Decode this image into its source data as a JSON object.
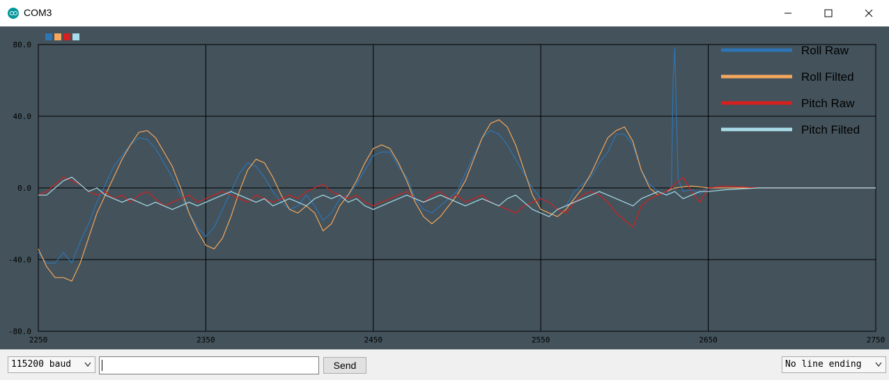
{
  "window": {
    "title": "COM3"
  },
  "plotter": {
    "legend_swatches": [
      "#2e75b6",
      "#f4a75d",
      "#d62020",
      "#a8dce8"
    ],
    "legend_panel": [
      {
        "label": "Roll Raw",
        "color": "#2e75b6"
      },
      {
        "label": "Roll Filted",
        "color": "#f4a75d"
      },
      {
        "label": "Pitch Raw",
        "color": "#d62020"
      },
      {
        "label": "Pitch Filted",
        "color": "#a8dce8"
      }
    ]
  },
  "chart_data": {
    "type": "line",
    "title": "",
    "xlabel": "",
    "ylabel": "",
    "xlim": [
      2250,
      2750
    ],
    "ylim": [
      -80,
      80
    ],
    "x_ticks": [
      "2250",
      "2350",
      "2450",
      "2550",
      "2650",
      "2750"
    ],
    "y_ticks": [
      "80.0",
      "40.0",
      "0.0",
      "-40.0",
      "-80.0"
    ],
    "grid": true,
    "series": [
      {
        "name": "Roll Raw",
        "color": "#2e75b6",
        "x": [
          2250,
          2255,
          2260,
          2265,
          2270,
          2275,
          2280,
          2285,
          2290,
          2295,
          2300,
          2305,
          2310,
          2315,
          2320,
          2325,
          2330,
          2335,
          2340,
          2345,
          2350,
          2355,
          2360,
          2365,
          2370,
          2375,
          2380,
          2385,
          2390,
          2395,
          2400,
          2405,
          2410,
          2415,
          2420,
          2425,
          2430,
          2435,
          2440,
          2445,
          2450,
          2455,
          2460,
          2465,
          2470,
          2475,
          2480,
          2485,
          2490,
          2495,
          2500,
          2505,
          2510,
          2515,
          2520,
          2525,
          2530,
          2535,
          2540,
          2545,
          2550,
          2555,
          2560,
          2565,
          2570,
          2575,
          2580,
          2585,
          2590,
          2595,
          2600,
          2605,
          2610,
          2615,
          2620,
          2625,
          2628,
          2629,
          2630,
          2632,
          2635,
          2640,
          2645,
          2650,
          2660,
          2680,
          2700,
          2720,
          2750
        ],
        "y": [
          -36,
          -42,
          -42,
          -36,
          -42,
          -30,
          -20,
          -8,
          2,
          12,
          18,
          24,
          28,
          27,
          22,
          14,
          6,
          -4,
          -14,
          -22,
          -27,
          -22,
          -12,
          -2,
          8,
          14,
          12,
          6,
          -2,
          -8,
          -12,
          -10,
          -4,
          -10,
          -18,
          -14,
          -6,
          -4,
          2,
          10,
          18,
          20,
          20,
          12,
          6,
          -6,
          -12,
          -14,
          -10,
          -6,
          -2,
          8,
          18,
          28,
          32,
          30,
          24,
          16,
          8,
          0,
          -6,
          -8,
          -12,
          -10,
          -2,
          2,
          6,
          14,
          20,
          30,
          30,
          24,
          10,
          2,
          -2,
          -4,
          0,
          60,
          78,
          5,
          -2,
          -1,
          -3,
          0,
          0,
          0,
          0,
          0,
          0
        ]
      },
      {
        "name": "Roll Filted",
        "color": "#f4a75d",
        "x": [
          2250,
          2255,
          2260,
          2265,
          2270,
          2275,
          2280,
          2285,
          2290,
          2295,
          2300,
          2305,
          2310,
          2315,
          2320,
          2325,
          2330,
          2335,
          2340,
          2345,
          2350,
          2355,
          2360,
          2365,
          2370,
          2375,
          2380,
          2385,
          2390,
          2395,
          2400,
          2405,
          2410,
          2415,
          2420,
          2425,
          2430,
          2435,
          2440,
          2445,
          2450,
          2455,
          2460,
          2465,
          2470,
          2475,
          2480,
          2485,
          2490,
          2495,
          2500,
          2505,
          2510,
          2515,
          2520,
          2525,
          2530,
          2535,
          2540,
          2545,
          2550,
          2555,
          2560,
          2565,
          2570,
          2575,
          2580,
          2585,
          2590,
          2595,
          2600,
          2605,
          2610,
          2615,
          2620,
          2625,
          2630,
          2640,
          2650,
          2660,
          2680,
          2700,
          2720,
          2750
        ],
        "y": [
          -34,
          -44,
          -50,
          -50,
          -52,
          -42,
          -28,
          -14,
          -4,
          6,
          16,
          24,
          31,
          32,
          28,
          20,
          12,
          0,
          -14,
          -24,
          -32,
          -34,
          -28,
          -16,
          -2,
          10,
          16,
          14,
          6,
          -4,
          -12,
          -14,
          -10,
          -14,
          -24,
          -20,
          -10,
          -4,
          4,
          14,
          22,
          24,
          22,
          14,
          4,
          -8,
          -16,
          -20,
          -16,
          -10,
          -4,
          4,
          16,
          28,
          36,
          38,
          34,
          24,
          10,
          -4,
          -12,
          -14,
          -16,
          -12,
          -6,
          0,
          8,
          18,
          28,
          32,
          34,
          26,
          10,
          0,
          -4,
          -2,
          0,
          1,
          0,
          0,
          0,
          0,
          0,
          0
        ]
      },
      {
        "name": "Pitch Raw",
        "color": "#d62020",
        "x": [
          2250,
          2255,
          2260,
          2265,
          2270,
          2275,
          2280,
          2285,
          2290,
          2295,
          2300,
          2305,
          2310,
          2315,
          2320,
          2325,
          2330,
          2335,
          2340,
          2345,
          2350,
          2355,
          2360,
          2365,
          2370,
          2375,
          2380,
          2385,
          2390,
          2395,
          2400,
          2405,
          2410,
          2415,
          2420,
          2425,
          2430,
          2435,
          2440,
          2445,
          2450,
          2455,
          2460,
          2465,
          2470,
          2475,
          2480,
          2485,
          2490,
          2495,
          2500,
          2505,
          2510,
          2515,
          2520,
          2525,
          2530,
          2535,
          2540,
          2545,
          2550,
          2555,
          2560,
          2565,
          2570,
          2575,
          2580,
          2585,
          2590,
          2595,
          2600,
          2605,
          2610,
          2615,
          2620,
          2625,
          2630,
          2635,
          2640,
          2645,
          2650,
          2660,
          2680,
          2700,
          2720,
          2750
        ],
        "y": [
          -4,
          -2,
          2,
          6,
          4,
          2,
          -2,
          -4,
          -2,
          -6,
          -4,
          -8,
          -4,
          -2,
          -6,
          -10,
          -8,
          -6,
          -4,
          -8,
          -6,
          -4,
          -2,
          -4,
          -6,
          -8,
          -4,
          -6,
          -8,
          -6,
          -4,
          -6,
          -2,
          0,
          2,
          -2,
          -4,
          -6,
          -4,
          -8,
          -10,
          -8,
          -6,
          -4,
          -2,
          -6,
          -8,
          -4,
          -2,
          -6,
          -4,
          -8,
          -6,
          -4,
          -8,
          -10,
          -12,
          -14,
          -10,
          -8,
          -6,
          -8,
          -12,
          -14,
          -8,
          -4,
          -2,
          -4,
          -8,
          -14,
          -18,
          -22,
          -10,
          -6,
          -4,
          -2,
          2,
          6,
          -2,
          -8,
          0,
          1,
          0,
          0,
          0,
          0
        ]
      },
      {
        "name": "Pitch Filted",
        "color": "#a8dce8",
        "x": [
          2250,
          2255,
          2260,
          2265,
          2270,
          2275,
          2280,
          2285,
          2290,
          2295,
          2300,
          2305,
          2310,
          2315,
          2320,
          2325,
          2330,
          2335,
          2340,
          2345,
          2350,
          2355,
          2360,
          2365,
          2370,
          2375,
          2380,
          2385,
          2390,
          2395,
          2400,
          2405,
          2410,
          2415,
          2420,
          2425,
          2430,
          2435,
          2440,
          2445,
          2450,
          2455,
          2460,
          2465,
          2470,
          2475,
          2480,
          2485,
          2490,
          2495,
          2500,
          2505,
          2510,
          2515,
          2520,
          2525,
          2530,
          2535,
          2540,
          2545,
          2550,
          2555,
          2560,
          2565,
          2570,
          2575,
          2580,
          2585,
          2590,
          2595,
          2600,
          2605,
          2610,
          2615,
          2620,
          2625,
          2630,
          2635,
          2640,
          2645,
          2650,
          2660,
          2680,
          2700,
          2720,
          2750
        ],
        "y": [
          -4,
          -4,
          0,
          4,
          6,
          2,
          -2,
          0,
          -4,
          -6,
          -8,
          -6,
          -8,
          -10,
          -8,
          -10,
          -12,
          -10,
          -8,
          -10,
          -8,
          -6,
          -4,
          -2,
          -4,
          -6,
          -8,
          -6,
          -10,
          -8,
          -6,
          -8,
          -10,
          -6,
          -4,
          -6,
          -4,
          -8,
          -6,
          -10,
          -12,
          -10,
          -8,
          -6,
          -4,
          -6,
          -8,
          -6,
          -4,
          -6,
          -8,
          -10,
          -8,
          -6,
          -8,
          -10,
          -6,
          -4,
          -8,
          -12,
          -14,
          -16,
          -12,
          -10,
          -8,
          -6,
          -4,
          -2,
          -4,
          -6,
          -8,
          -10,
          -6,
          -4,
          -2,
          -4,
          -2,
          -6,
          -4,
          -2,
          -2,
          -1,
          0,
          0,
          0,
          0
        ]
      }
    ]
  },
  "bottombar": {
    "baud": "115200 baud",
    "send_label": "Send",
    "input_value": "",
    "line_ending": "No line ending"
  }
}
